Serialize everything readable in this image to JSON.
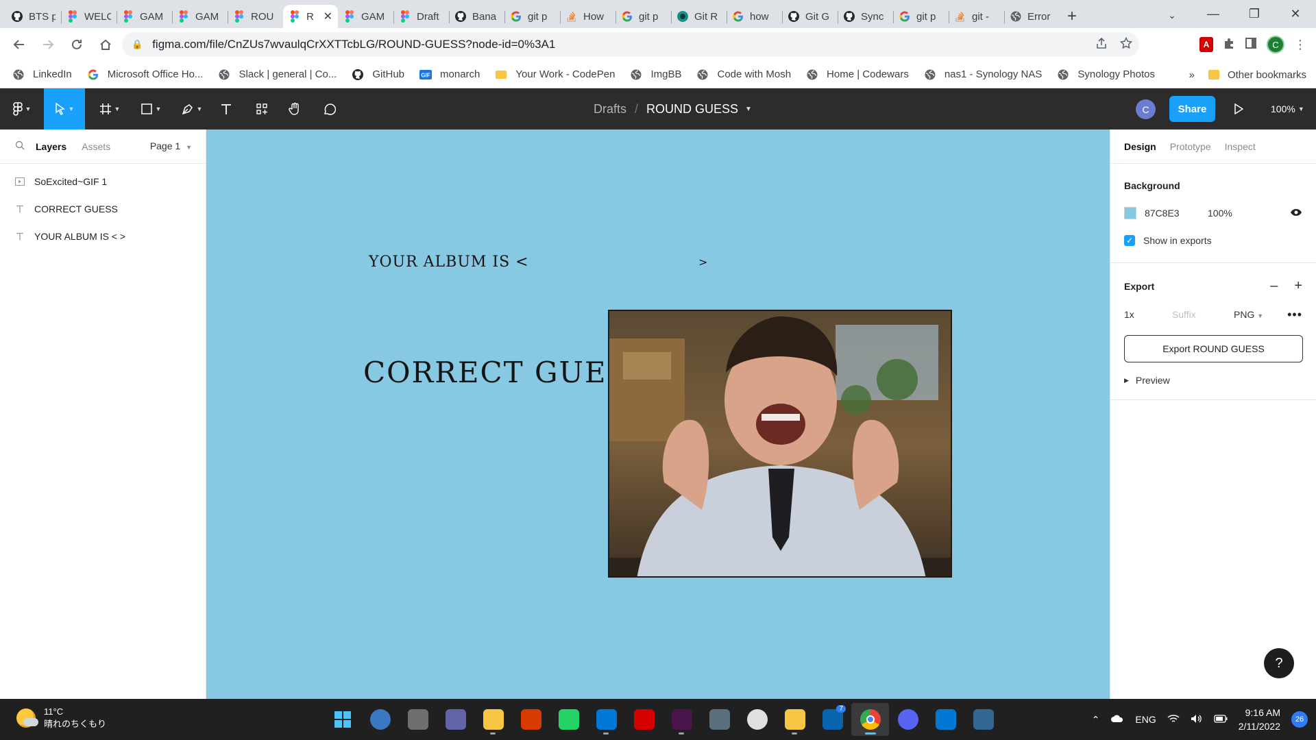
{
  "browser": {
    "tabs": [
      {
        "title": "BTS p",
        "icon": "github-icon"
      },
      {
        "title": "WELC",
        "icon": "figma-icon"
      },
      {
        "title": "GAM",
        "icon": "figma-icon"
      },
      {
        "title": "GAM",
        "icon": "figma-icon"
      },
      {
        "title": "ROU",
        "icon": "figma-icon"
      },
      {
        "title": "R",
        "icon": "figma-icon",
        "active": true
      },
      {
        "title": "GAM",
        "icon": "figma-icon"
      },
      {
        "title": "Draft",
        "icon": "figma-icon"
      },
      {
        "title": "Bana",
        "icon": "github-icon"
      },
      {
        "title": "git p",
        "icon": "google-icon"
      },
      {
        "title": "How",
        "icon": "stackoverflow-icon"
      },
      {
        "title": "git p",
        "icon": "google-icon"
      },
      {
        "title": "Git R",
        "icon": "gitkraken-icon"
      },
      {
        "title": "how",
        "icon": "google-icon"
      },
      {
        "title": "Git G",
        "icon": "github-icon"
      },
      {
        "title": "Sync",
        "icon": "github-icon"
      },
      {
        "title": "git p",
        "icon": "google-icon"
      },
      {
        "title": "git -",
        "icon": "stackoverflow-icon"
      },
      {
        "title": "Error",
        "icon": "globe-icon"
      }
    ],
    "url": "figma.com/file/CnZUs7wvaulqCrXXTTcbLG/ROUND-GUESS?node-id=0%3A1",
    "profile_initial": "C",
    "bookmarks": [
      {
        "label": "LinkedIn",
        "icon": "globe-icon"
      },
      {
        "label": "Microsoft Office Ho...",
        "icon": "google-icon"
      },
      {
        "label": "Slack | general | Co...",
        "icon": "globe-icon"
      },
      {
        "label": "GitHub",
        "icon": "github-icon"
      },
      {
        "label": "monarch",
        "icon": "gif-icon"
      },
      {
        "label": "Your Work - CodePen",
        "icon": "codepen-icon"
      },
      {
        "label": "ImgBB",
        "icon": "globe-icon"
      },
      {
        "label": "Code with Mosh",
        "icon": "globe-icon"
      },
      {
        "label": "Home | Codewars",
        "icon": "globe-icon"
      },
      {
        "label": "nas1 - Synology NAS",
        "icon": "globe-icon"
      },
      {
        "label": "Synology Photos",
        "icon": "globe-icon"
      }
    ],
    "bookmarks_overflow": "»",
    "other_bookmarks": "Other bookmarks"
  },
  "figma": {
    "breadcrumb": {
      "project": "Drafts",
      "separator": "/",
      "file": "ROUND GUESS"
    },
    "user_initial": "C",
    "share_label": "Share",
    "zoom": "100%",
    "left_panel": {
      "tab_layers": "Layers",
      "tab_assets": "Assets",
      "page": "Page 1",
      "layers": [
        {
          "name": "SoExcited~GIF 1",
          "type": "gif"
        },
        {
          "name": "CORRECT GUESS",
          "type": "text"
        },
        {
          "name": "YOUR ALBUM IS < >",
          "type": "text"
        }
      ]
    },
    "canvas": {
      "background": "#87C8E3",
      "album_text": "YOUR ALBUM IS <",
      "album_close": ">",
      "correct_text": "CORRECT GUESS"
    },
    "right_panel": {
      "tab_design": "Design",
      "tab_prototype": "Prototype",
      "tab_inspect": "Inspect",
      "background_title": "Background",
      "bg_hex": "87C8E3",
      "bg_opacity": "100%",
      "show_in_exports": "Show in exports",
      "export_title": "Export",
      "export_scale": "1x",
      "export_suffix_placeholder": "Suffix",
      "export_format": "PNG",
      "export_button": "Export ROUND GUESS",
      "preview": "Preview"
    },
    "help": "?"
  },
  "taskbar": {
    "temperature": "11°C",
    "weather": "晴れのちくもり",
    "apps": [
      {
        "name": "start-icon",
        "color": "#4cc2ff",
        "glyph": ""
      },
      {
        "name": "search-icon",
        "color": "#3b78c2",
        "glyph": ""
      },
      {
        "name": "task-view-icon",
        "color": "#6f6f6f",
        "glyph": ""
      },
      {
        "name": "teams-chat-icon",
        "color": "#6264a7",
        "glyph": ""
      },
      {
        "name": "file-explorer-icon",
        "color": "#f6c644",
        "glyph": "",
        "open": true
      },
      {
        "name": "office-icon",
        "color": "#d83b01",
        "glyph": ""
      },
      {
        "name": "whatsapp-icon",
        "color": "#25d366",
        "glyph": ""
      },
      {
        "name": "vscode-icon",
        "color": "#0078d7",
        "glyph": "",
        "open": true
      },
      {
        "name": "acrobat-icon",
        "color": "#d50000",
        "glyph": ""
      },
      {
        "name": "slack-icon",
        "color": "#4a154b",
        "glyph": "",
        "open": true
      },
      {
        "name": "calculator-icon",
        "color": "#5a6f7b",
        "glyph": ""
      },
      {
        "name": "clock-icon",
        "color": "#e0e0e0",
        "glyph": ""
      },
      {
        "name": "figma-folder-icon",
        "color": "#f6c644",
        "glyph": "",
        "open": true
      },
      {
        "name": "mail-icon",
        "color": "#0a64ad",
        "glyph": "",
        "badge": "7"
      },
      {
        "name": "chrome-icon",
        "color": "#1a73e8",
        "glyph": "",
        "active": true
      },
      {
        "name": "discord-icon",
        "color": "#5865f2",
        "glyph": ""
      },
      {
        "name": "store-icon",
        "color": "#0078d4",
        "glyph": ""
      },
      {
        "name": "postgres-icon",
        "color": "#336791",
        "glyph": ""
      }
    ],
    "language": "ENG",
    "time": "9:16 AM",
    "date": "2/11/2022",
    "notifications": "26"
  }
}
